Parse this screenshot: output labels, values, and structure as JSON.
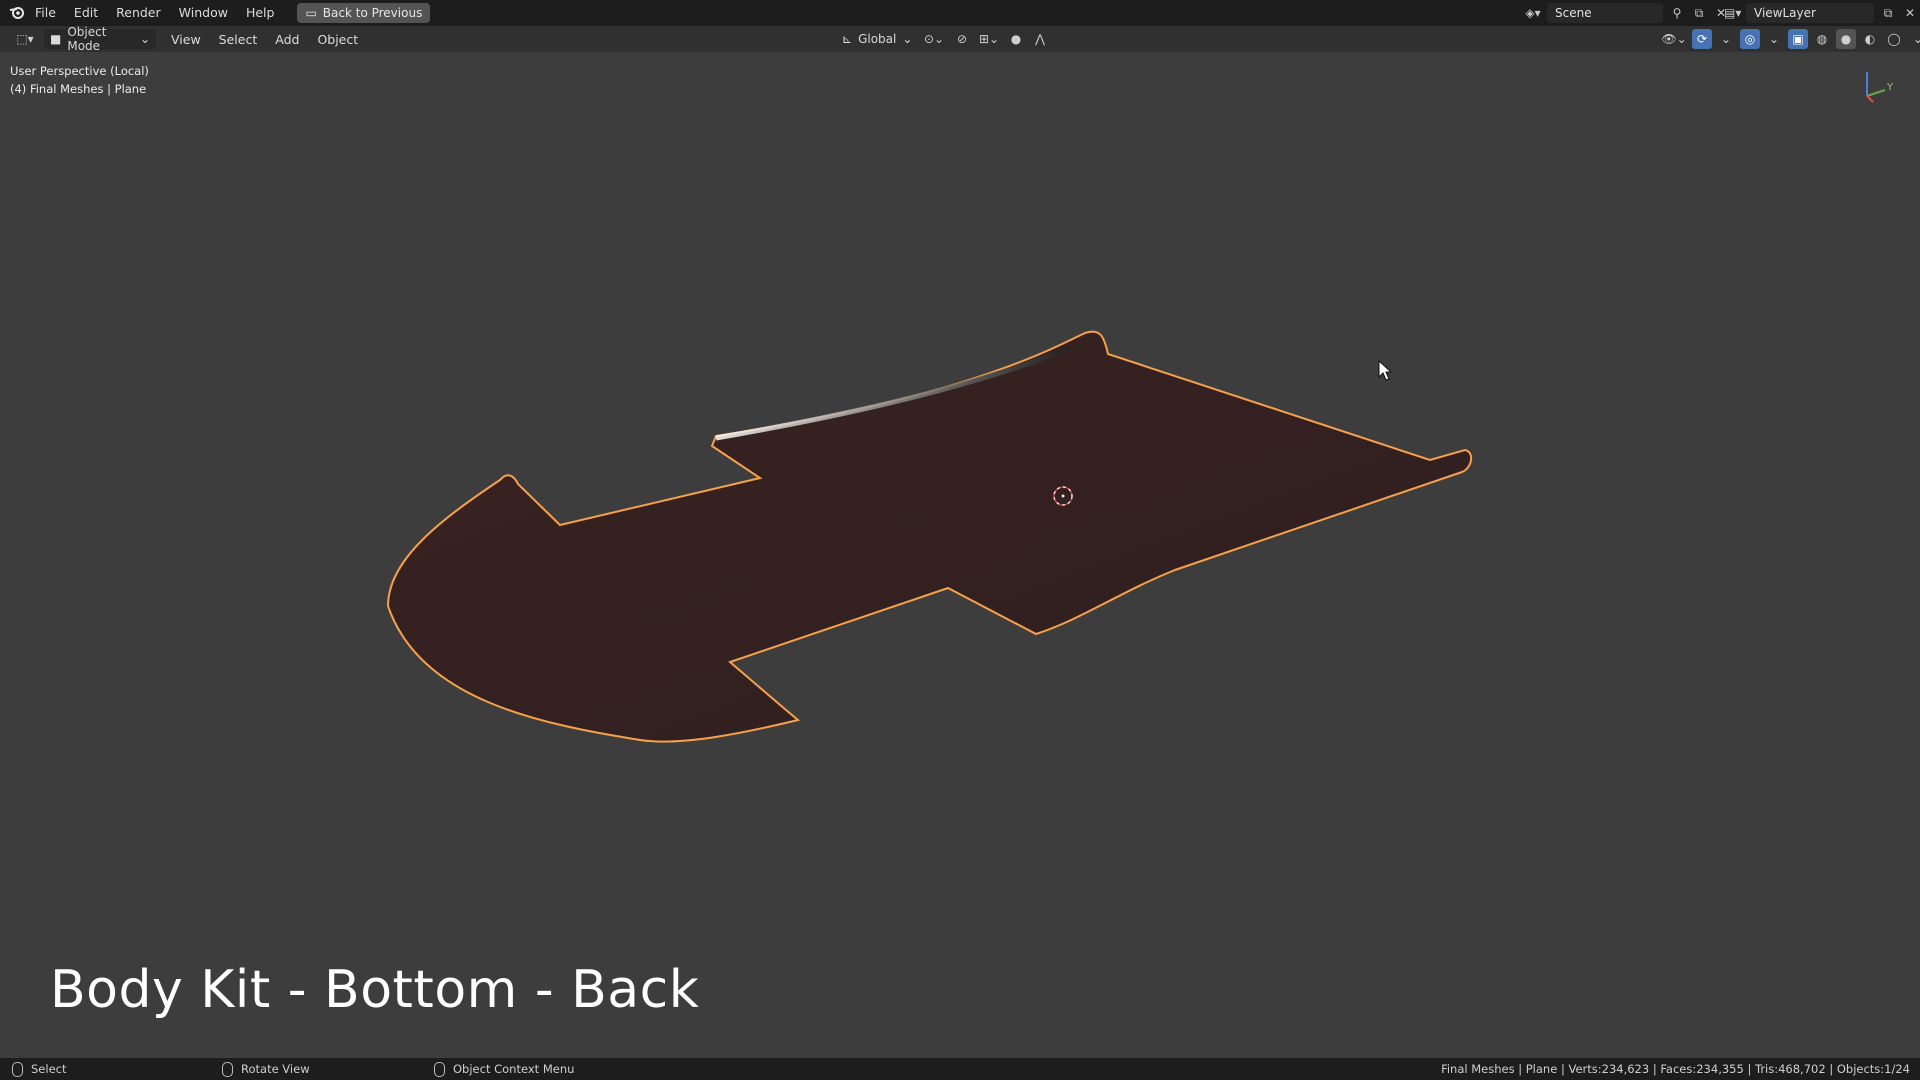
{
  "topbar": {
    "logo_icon": "blender-logo-icon",
    "menus": [
      "File",
      "Edit",
      "Render",
      "Window",
      "Help"
    ],
    "back_button": "Back to Previous",
    "scene_name": "Scene",
    "view_layer": "ViewLayer"
  },
  "header": {
    "mode": "Object Mode",
    "menus": [
      "View",
      "Select",
      "Add",
      "Object"
    ],
    "transform_orientation": "Global"
  },
  "viewport": {
    "perspective": "User Perspective (Local)",
    "collection_info": "(4) Final Meshes | Plane",
    "gizmo_axis_label": "Y",
    "selection_outline_color": "#f7a14a",
    "mesh_color": "#3a2424"
  },
  "caption": "Body Kit - Bottom - Back",
  "statusbar": {
    "select": "Select",
    "rotate": "Rotate View",
    "context_menu": "Object Context Menu",
    "stats": "Final Meshes | Plane | Verts:234,623 | Faces:234,355 | Tris:468,702 | Objects:1/24"
  }
}
